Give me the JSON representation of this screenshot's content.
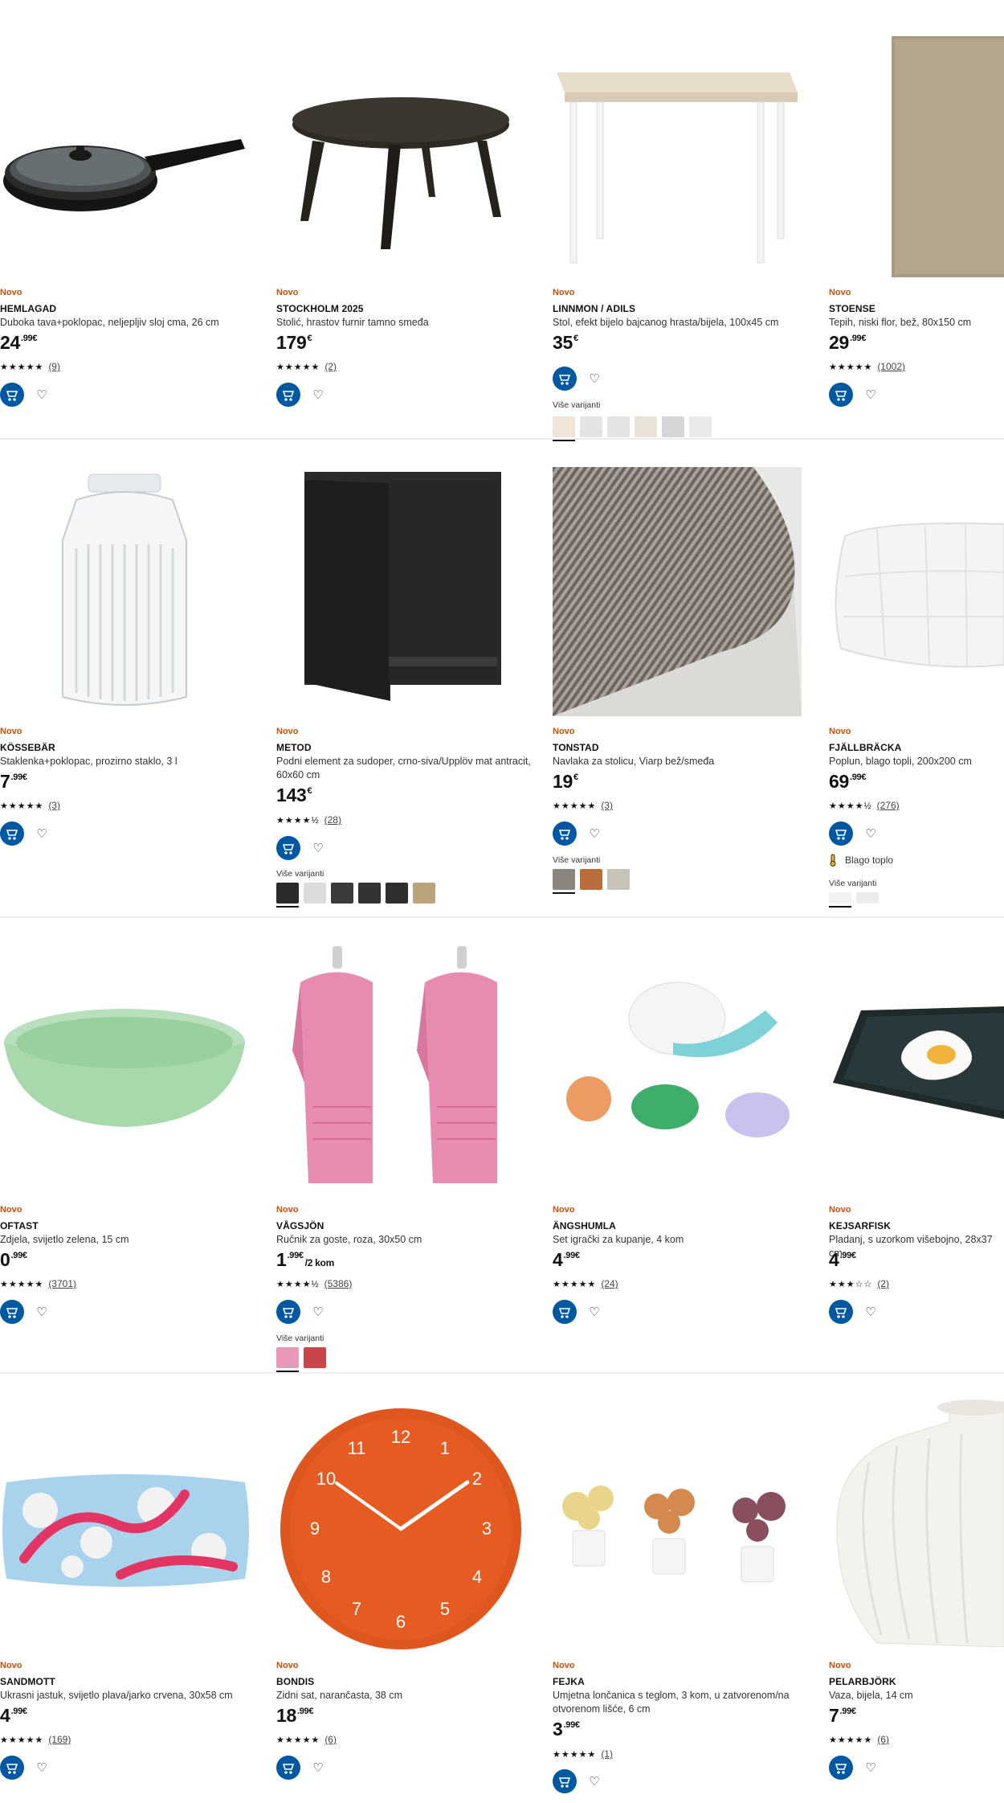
{
  "common": {
    "new_badge": "Novo",
    "variants_label": "Više varijanti",
    "stars_full": "★★★★★",
    "stars_4half": "★★★★½",
    "stars_3": "★★★☆☆"
  },
  "products": [
    {
      "badge": "Novo",
      "name": "HEMLAGAD",
      "desc": "Duboka tava+poklopac, neljepljiv sloj cma, 26 cm",
      "price_int": "24",
      "price_cents": ".99€",
      "rating": "(9)",
      "image": "frying-pan"
    },
    {
      "badge": "Novo",
      "name": "STOCKHOLM 2025",
      "desc": "Stolić, hrastov furnir tamno smeđa",
      "price_int": "179",
      "price_cents": "€",
      "rating": "(2)",
      "image": "coffee-table"
    },
    {
      "badge": "Novo",
      "name": "LINNMON / ADILS",
      "desc": "Stol, efekt bijelo bajcanog hrasta/bijela, 100x45 cm",
      "price_int": "35",
      "price_cents": "€",
      "rating": "",
      "image": "desk"
    },
    {
      "badge": "Novo",
      "name": "STOENSE",
      "desc": "Tepih, niski flor, bež, 80x150 cm",
      "price_int": "29",
      "price_cents": ".99€",
      "rating": "(1002)",
      "image": "rug"
    },
    {
      "badge": "Novo",
      "name": "KÖSSEBÄR",
      "desc": "Staklenka+poklopac, prozirno staklo, 3 l",
      "price_int": "7",
      "price_cents": ".99€",
      "rating": "(3)",
      "image": "glass-jar"
    },
    {
      "badge": "Novo",
      "name": "METOD",
      "desc": "Podni element za sudoper, crno-siva/Upplöv mat antracit, 60x60 cm",
      "price_int": "143",
      "price_cents": "€",
      "rating": "(28)",
      "image": "cabinet"
    },
    {
      "badge": "Novo",
      "name": "TONSTAD",
      "desc": "Navlaka za stolicu, Viarp bež/smeđa",
      "price_int": "19",
      "price_cents": "€",
      "rating": "(3)",
      "image": "fabric"
    },
    {
      "badge": "Novo",
      "name": "FJÄLLBRÄCKA",
      "desc": "Poplun, blago topli, 200x200 cm",
      "price_int": "69",
      "price_cents": ".99€",
      "rating": "(276)",
      "image": "duvet",
      "feature": "Blago toplo"
    },
    {
      "badge": "Novo",
      "name": "OFTAST",
      "desc": "Zdjela, svijetlo zelena, 15 cm",
      "price_int": "0",
      "price_cents": ".99€",
      "rating": "(3701)",
      "image": "green-bowl"
    },
    {
      "badge": "Novo",
      "name": "VÅGSJÖN",
      "desc": "Ručnik za goste, roza, 30x50 cm",
      "price_int": "1",
      "price_cents": ".99€",
      "price_unit": "/2 kom",
      "rating": "(5386)",
      "image": "pink-towels"
    },
    {
      "badge": "Novo",
      "name": "ÄNGSHUMLA",
      "desc": "Set igrački za kupanje, 4 kom",
      "price_int": "4",
      "price_cents": ".99€",
      "rating": "(24)",
      "image": "bath-toys"
    },
    {
      "badge": "Novo",
      "name": "KEJSARFISK",
      "desc": "Pladanj, s uzorkom višebojno, 28x37 cm",
      "price_int": "4",
      "price_cents": ".99€",
      "rating": "(2)",
      "image": "tray"
    },
    {
      "badge": "Novo",
      "name": "SANDMOTT",
      "desc": "Ukrasni jastuk, svijetlo plava/jarko crvena, 30x58 cm",
      "price_int": "4",
      "price_cents": ".99€",
      "rating": "(169)",
      "image": "cushion"
    },
    {
      "badge": "Novo",
      "name": "BONDIS",
      "desc": "Zidni sat, narančasta, 38 cm",
      "price_int": "18",
      "price_cents": ".99€",
      "rating": "(6)",
      "image": "wall-clock"
    },
    {
      "badge": "Novo",
      "name": "FEJKA",
      "desc": "Umjetna lončanica s teglom, 3 kom, u zatvorenom/na otvorenom lišće, 6 cm",
      "price_int": "3",
      "price_cents": ".99€",
      "rating": "(1)",
      "image": "plants"
    },
    {
      "badge": "Novo",
      "name": "PELARBJÖRK",
      "desc": "Vaza, bijela, 14 cm",
      "price_int": "7",
      "price_cents": ".99€",
      "rating": "(6)",
      "image": "vase"
    }
  ],
  "colors": {
    "brand_blue": "#0058a3",
    "new_orange": "#ca5008"
  }
}
